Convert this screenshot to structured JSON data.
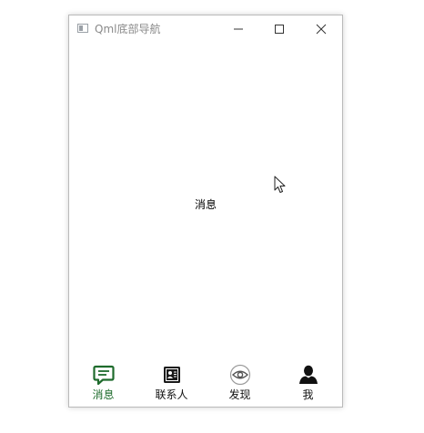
{
  "window": {
    "title": "Qml底部导航"
  },
  "main": {
    "content_label": "消息"
  },
  "nav": {
    "items": [
      {
        "label": "消息",
        "icon": "message-icon",
        "active": true
      },
      {
        "label": "联系人",
        "icon": "contacts-icon",
        "active": false
      },
      {
        "label": "发现",
        "icon": "eye-icon",
        "active": false
      },
      {
        "label": "我",
        "icon": "user-icon",
        "active": false
      }
    ]
  },
  "colors": {
    "accent": "#1e6b2c",
    "text": "#111111",
    "title": "#8a8a8a"
  }
}
